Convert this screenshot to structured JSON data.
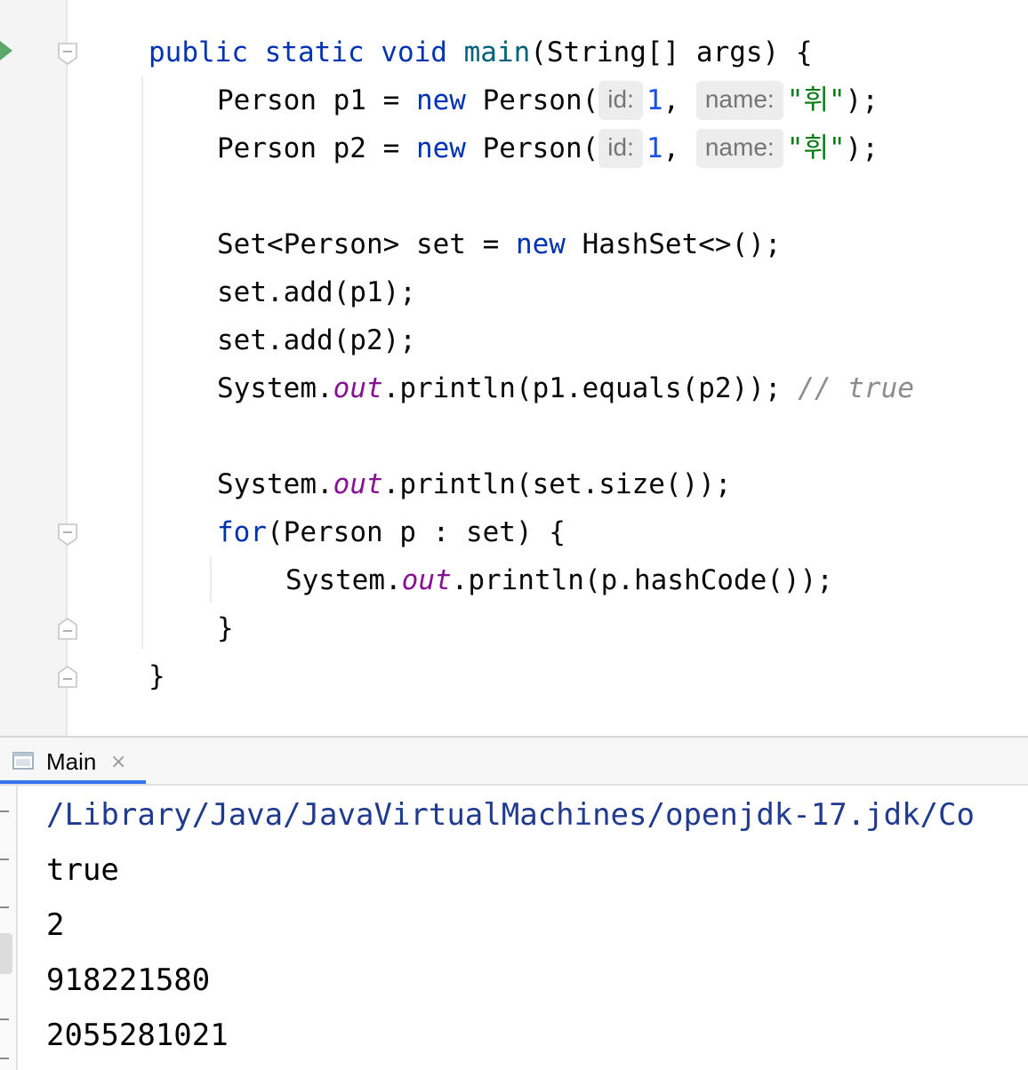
{
  "editor": {
    "lines": {
      "l1": {
        "kw1": "public static void ",
        "fn": "main",
        "rest": "(String[] args) {"
      },
      "l2": {
        "a": "Person p1 = ",
        "kw": "new",
        "b": " Person(",
        "hint_id": "id:",
        "num": "1",
        "c": ", ",
        "hint_name": "name:",
        "str": "\"휘\"",
        "d": ");"
      },
      "l3": {
        "a": "Person p2 = ",
        "kw": "new",
        "b": " Person(",
        "hint_id": "id:",
        "num": "1",
        "c": ", ",
        "hint_name": "name:",
        "str": "\"휘\"",
        "d": ");"
      },
      "l5": {
        "a": "Set<Person> set = ",
        "kw": "new",
        "b": " HashSet<>();"
      },
      "l6": {
        "a": "set.add(p1);"
      },
      "l7": {
        "a": "set.add(p2);"
      },
      "l8": {
        "a": "System.",
        "field": "out",
        "b": ".println(p1.equals(p2)); ",
        "cmt": "// true"
      },
      "l10": {
        "a": "System.",
        "field": "out",
        "b": ".println(set.size());"
      },
      "l11": {
        "kw": "for",
        "b": "(Person p : set) {"
      },
      "l12": {
        "a": "System.",
        "field": "out",
        "b": ".println(p.hashCode());"
      },
      "l13": {
        "a": "}"
      },
      "l14": {
        "a": "}"
      }
    }
  },
  "run": {
    "tab_label": "Main",
    "tab_close": "×",
    "console": {
      "path": "/Library/Java/JavaVirtualMachines/openjdk-17.jdk/Co",
      "out1": "true",
      "out2": "2",
      "out3": "918221580",
      "out4": "2055281021"
    }
  },
  "colors": {
    "keyword": "#0033b3",
    "method": "#00627a",
    "number": "#1750eb",
    "string": "#067d17",
    "static_field": "#871094",
    "comment": "#8c8c8c",
    "run_icon": "#59a869",
    "tab_underline": "#3574f0"
  },
  "icons": [
    "run-gutter-icon",
    "fold-icon",
    "console-tab-icon",
    "close-icon"
  ]
}
